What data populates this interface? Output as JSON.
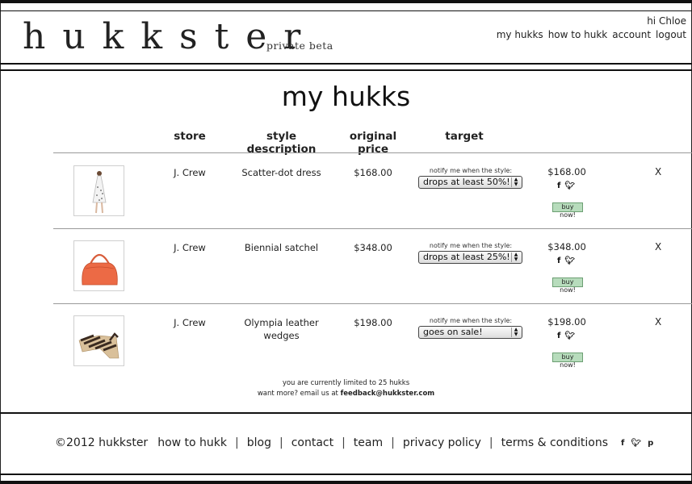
{
  "header": {
    "logo": "hukkster",
    "beta": "private beta",
    "greeting": "hi Chloe",
    "nav": [
      "my hukks",
      "how to hukk",
      "account",
      "logout"
    ]
  },
  "main": {
    "title": "my hukks",
    "columns": {
      "store": "store",
      "style": "style description",
      "price": "original price",
      "target": "target"
    },
    "notify_label": "notify me when the style:",
    "buy_label": "buy now!",
    "remove_label": "X",
    "social": {
      "facebook": "f",
      "twitter": "t"
    },
    "items": [
      {
        "store": "J. Crew",
        "style": "Scatter-dot dress",
        "price": "$168.00",
        "target": "drops at least 50%!",
        "current": "$168.00"
      },
      {
        "store": "J. Crew",
        "style": "Biennial satchel",
        "price": "$348.00",
        "target": "drops at least 25%!",
        "current": "$348.00"
      },
      {
        "store": "J. Crew",
        "style": "Olympia leather wedges",
        "price": "$198.00",
        "target": "goes on sale!",
        "current": "$198.00"
      }
    ],
    "limit_line1": "you are currently limited to 25 hukks",
    "limit_line2_prefix": "want more? email us at",
    "limit_email": "feedback@hukkster.com"
  },
  "footer": {
    "copyright": "©2012 hukkster",
    "links": [
      "how to hukk",
      "blog",
      "contact",
      "team",
      "privacy policy",
      "terms & conditions"
    ],
    "separator": "|",
    "social": {
      "facebook": "f",
      "twitter": "t",
      "pinterest": "p"
    }
  }
}
